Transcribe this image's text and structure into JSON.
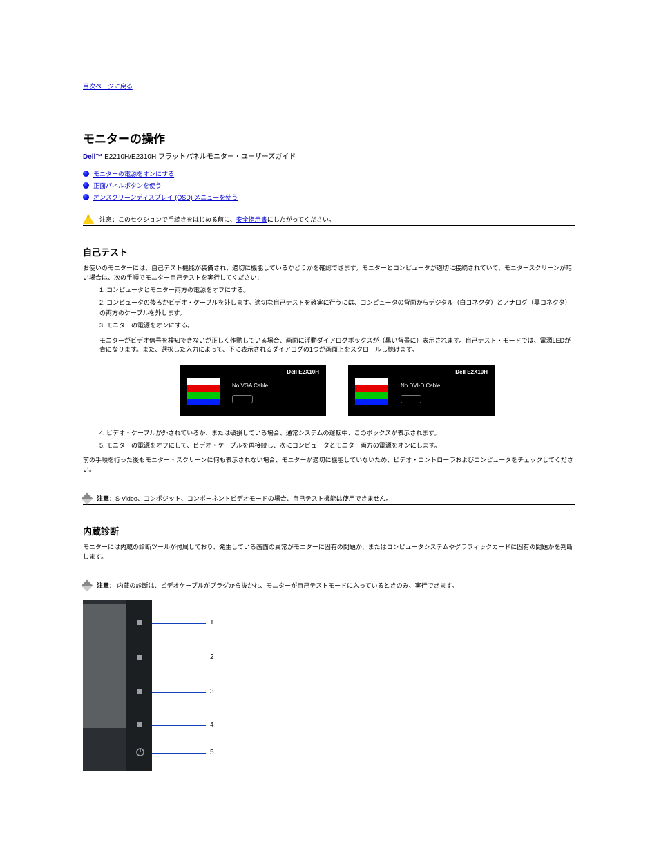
{
  "toc_link": "目次ページに戻る",
  "section": {
    "title": "モニターの操作",
    "subtitle_prefix": "Dell™",
    "subtitle_rest": " E2210H/E2310H フラットパネルモニター・ユーザーズガイド"
  },
  "bullets": [
    {
      "label": "モニターの電源をオンにする"
    },
    {
      "label": "正面パネルボタンを使う"
    },
    {
      "label": "オンスクリーンディスプレイ (OSD) メニューを使う"
    }
  ],
  "caution": {
    "prefix": "注意：このセクションで手続きをはじめる前に、",
    "link": "安全指示書",
    "suffix": "にしたがってください。"
  },
  "self_test": {
    "heading": "自己テスト",
    "p1": "お使いのモニターには、自己テスト機能が装備され、適切に機能しているかどうかを確認できます。モニターとコンピュータが適切に接続されていて、モニタースクリーンが暗い場合は、次の手順でモニター自己テストを実行してください：",
    "steps": [
      "1. コンピュータとモニター両方の電源をオフにする。",
      "2. コンピュータの後ろかビデオ・ケーブルを外します。適切な自己テストを確実に行うには、コンピュータの背面からデジタル（白コネクタ）とアナログ（黒コネクタ）の両方のケーブルを外します。",
      "3. モニターの電源をオンにする。"
    ],
    "p2": "モニターがビデオ信号を検知できないが正しく作動している場合、画面に浮動ダイアログボックスが（黒い背景に）表示されます。自己テスト・モードでは、電源LEDが青になります。また、選択した入力によって、下に表示されるダイアログの1つが画面上をスクロールし続けます。",
    "p3_step4": "4. ビデオ・ケーブルが外されているか、または破損している場合、通常システムの運転中、このボックスが表示されます。",
    "p3_step5": "5. モニターの電源をオフにして、ビデオ・ケーブルを再接続し、次にコンピュータとモニター両方の電源をオンにします。",
    "p4": "前の手順を行った後もモニター・スクリーンに何も表示されない場合、モニターが適切に機能していないため、ビデオ・コントローラおよびコンピュータをチェックしてください。"
  },
  "dialogs": {
    "model_vga": "Dell E2X10H",
    "msg_vga": "No VGA Cable",
    "model_dvi": "Dell E2X10H",
    "msg_dvi": "No DVI-D Cable"
  },
  "note1": {
    "label": "注意：",
    "text": "S-Video、コンポジット、コンポーネントビデオモードの場合、自己テスト機能は使用できません。"
  },
  "diag": {
    "heading": "内蔵診断",
    "p1": "モニターには内蔵の診断ツールが付属しており、発生している画面の異常がモニターに固有の問題か、またはコンピュータシステムやグラフィックカードに固有の問題かを判断します。"
  },
  "note2": {
    "label": "注意：",
    "text": " 内蔵の診断は、ビデオケーブルがプラグから抜かれ、モニターが自己テストモードに入っているときのみ、実行できます。"
  },
  "leads": {
    "n1": "1",
    "n2": "2",
    "n3": "3",
    "n4": "4",
    "n5": "5"
  }
}
